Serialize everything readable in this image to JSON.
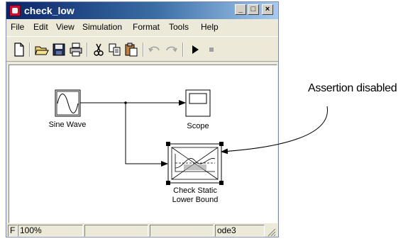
{
  "window": {
    "title": "check_low"
  },
  "titlebar_buttons": {
    "minimize": "_",
    "maximize": "□",
    "close": "×"
  },
  "menu": {
    "items": [
      "File",
      "Edit",
      "View",
      "Simulation",
      "Format",
      "Tools",
      "Help"
    ]
  },
  "toolbar": {
    "icons": [
      "new-icon",
      "open-icon",
      "save-icon",
      "print-icon",
      "cut-icon",
      "copy-icon",
      "paste-icon",
      "undo-icon",
      "redo-icon",
      "start-simulation-icon",
      "stop-simulation-icon"
    ]
  },
  "model": {
    "blocks": {
      "sine": {
        "label": "Sine Wave"
      },
      "scope": {
        "label": "Scope"
      },
      "check": {
        "label_line1": "Check Static",
        "label_line2": "Lower Bound"
      }
    }
  },
  "statusbar": {
    "cell1": "F",
    "zoom": "100%",
    "cell3": "",
    "cell4": "",
    "solver": "ode3"
  },
  "annotation": {
    "text": "Assertion disabled"
  },
  "colors": {
    "title_start": "#0a246a",
    "title_end": "#a6caf0",
    "chrome": "#ece9d8"
  }
}
